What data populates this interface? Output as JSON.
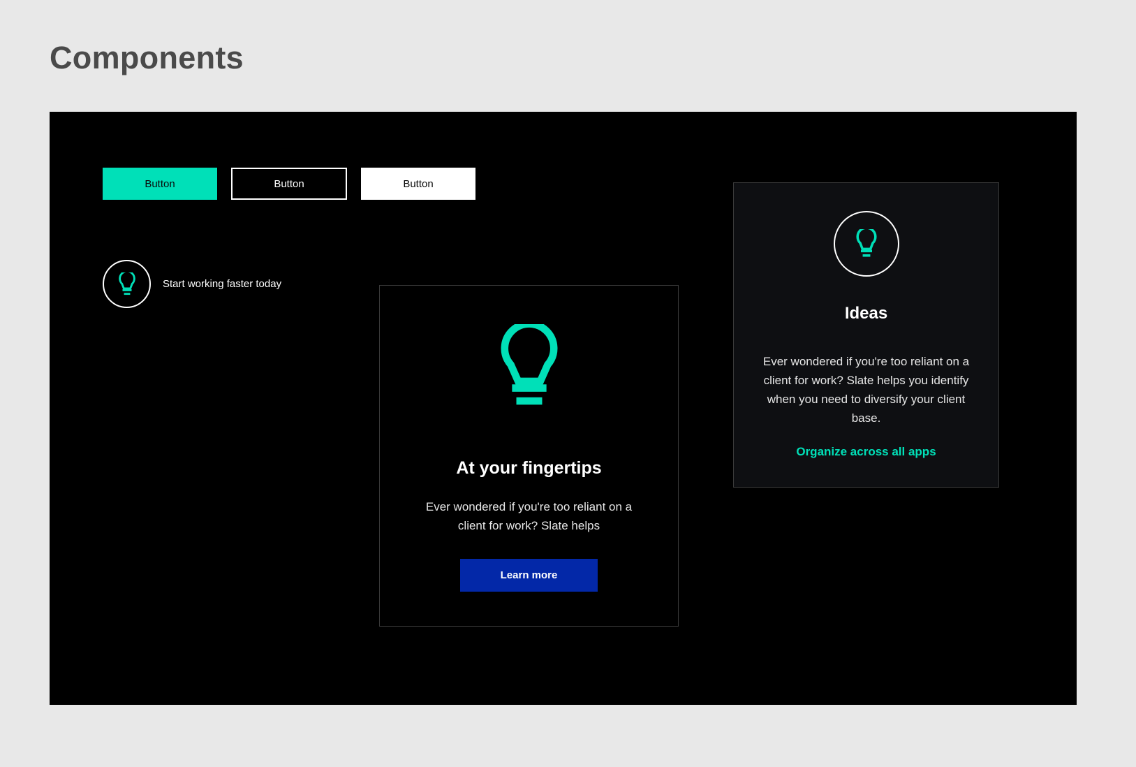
{
  "page": {
    "title": "Components"
  },
  "colors": {
    "background": "#e8e8e8",
    "canvas": "#000000",
    "accent": "#00e0b8",
    "primary_blue": "#0328a8",
    "card_dark": "#0e0f12"
  },
  "buttons": {
    "primary_label": "Button",
    "outline_label": "Button",
    "light_label": "Button"
  },
  "feature": {
    "icon": "lightbulb-icon",
    "text": "Start working faster today"
  },
  "card_center": {
    "icon": "lightbulb-icon",
    "title": "At your fingertips",
    "body": "Ever wondered if you're too reliant on a client for work? Slate helps",
    "cta_label": "Learn more"
  },
  "card_right": {
    "icon": "lightbulb-icon",
    "title": "Ideas",
    "body": "Ever wondered if you're too reliant on a client for work? Slate helps you identify when you need to diversify your client base.",
    "link_label": "Organize across all apps"
  }
}
